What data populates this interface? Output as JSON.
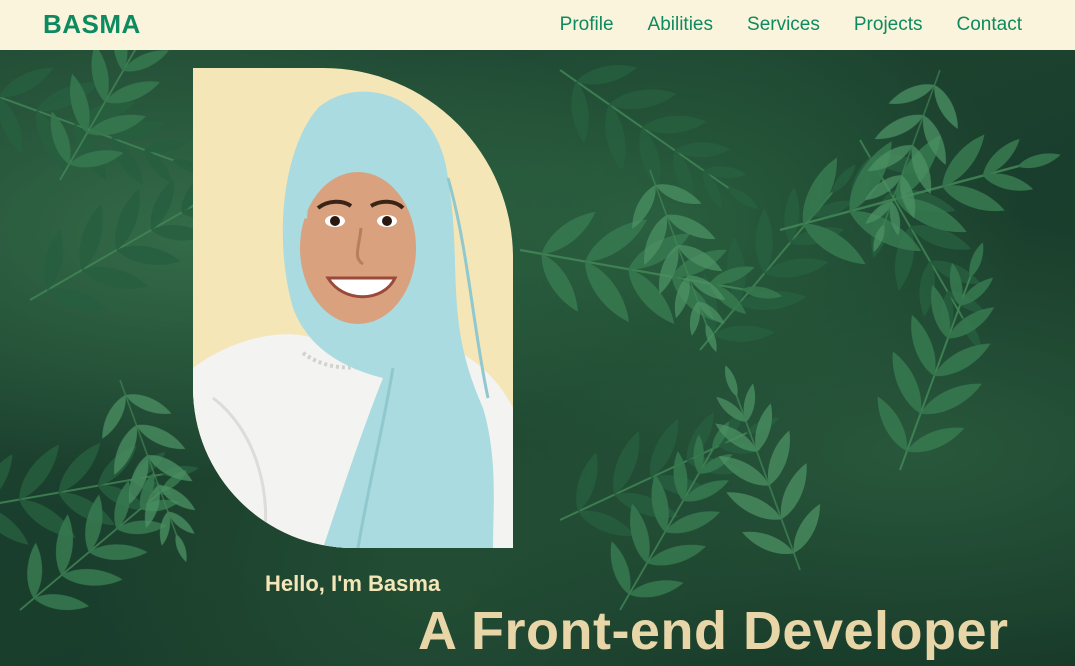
{
  "navbar": {
    "brand": "BASMA",
    "links": [
      "Profile",
      "Abilities",
      "Services",
      "Projects",
      "Contact"
    ]
  },
  "hero": {
    "greeting": "Hello, I'm Basma",
    "title": "A Front-end Developer"
  },
  "colors": {
    "nav_background": "#fbf4dc",
    "brand_green": "#0d8a5f",
    "card_cream": "#f5e6b8",
    "title_cream": "#e8d6a8",
    "foliage_dark": "#1d4331"
  },
  "icons": {
    "background": "fern-leaves-photo",
    "portrait": "profile-photo"
  }
}
